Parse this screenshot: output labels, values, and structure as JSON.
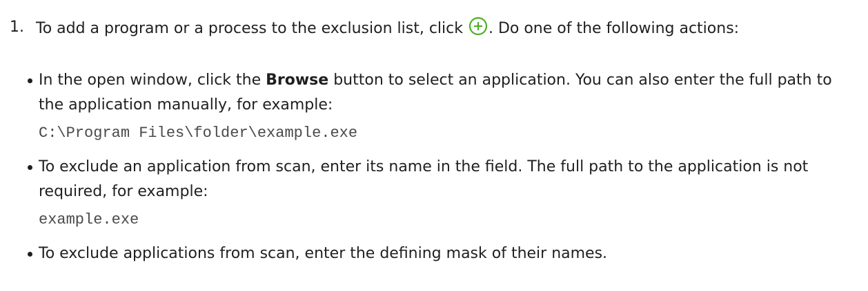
{
  "step": {
    "number": "1.",
    "text_before_icon": "To add a program or a process to the exclusion list, click ",
    "icon": "add-circle-icon",
    "icon_color": "#4caf26",
    "text_after_icon": ". Do one of the following actions:"
  },
  "bullets": [
    {
      "text_before_bold": "In the open window, click the ",
      "bold": "Browse",
      "text_after_bold": " button to select an application. You can also enter the full path to the application manually, for example:",
      "code": "C:\\Program Files\\folder\\example.exe"
    },
    {
      "text": "To exclude an application from scan, enter its name in the field. The full path to the application is not required, for example:",
      "code": "example.exe"
    },
    {
      "text": "To exclude applications from scan, enter the defining mask of their names."
    }
  ]
}
